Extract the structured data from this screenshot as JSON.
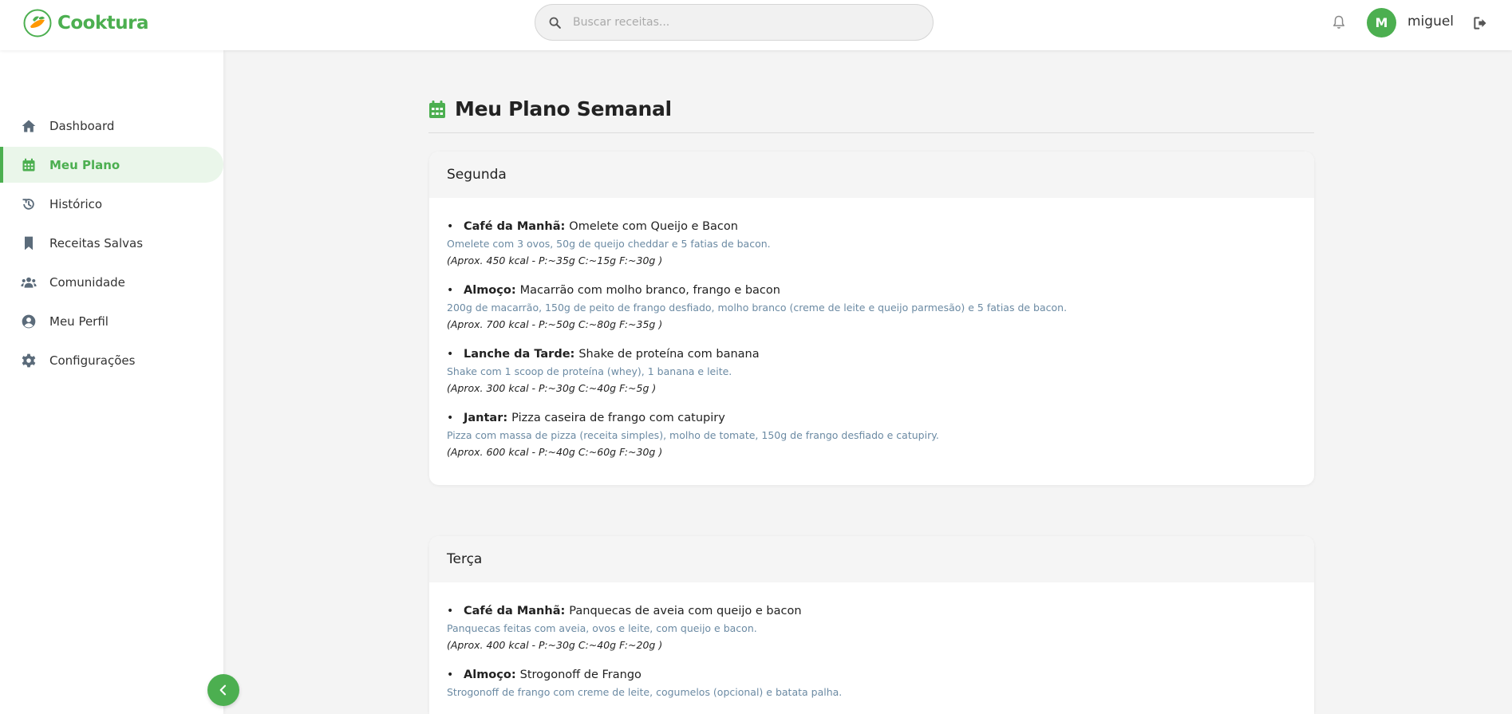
{
  "header": {
    "brand": "Cooktura",
    "search_placeholder": "Buscar receitas...",
    "user_initial": "M",
    "username": "miguel"
  },
  "sidebar": {
    "items": [
      {
        "label": "Dashboard",
        "icon": "home-icon"
      },
      {
        "label": "Meu Plano",
        "icon": "calendar-icon",
        "active": true
      },
      {
        "label": "Histórico",
        "icon": "history-icon"
      },
      {
        "label": "Receitas Salvas",
        "icon": "bookmark-icon"
      },
      {
        "label": "Comunidade",
        "icon": "users-icon"
      },
      {
        "label": "Meu Perfil",
        "icon": "user-circle-icon"
      },
      {
        "label": "Configurações",
        "icon": "gear-icon"
      }
    ]
  },
  "main": {
    "title": "Meu Plano Semanal",
    "days": [
      {
        "name": "Segunda",
        "meals": [
          {
            "type": "Café da Manhã:",
            "name": "Omelete com Queijo e Bacon",
            "desc": "Omelete com 3 ovos, 50g de queijo cheddar e 5 fatias de bacon.",
            "macros": "(Aprox. 450 kcal - P:~35g C:~15g F:~30g )"
          },
          {
            "type": "Almoço:",
            "name": "Macarrão com molho branco, frango e bacon",
            "desc": "200g de macarrão, 150g de peito de frango desfiado, molho branco (creme de leite e queijo parmesão) e 5 fatias de bacon.",
            "macros": "(Aprox. 700 kcal - P:~50g C:~80g F:~35g )"
          },
          {
            "type": "Lanche da Tarde:",
            "name": "Shake de proteína com banana",
            "desc": "Shake com 1 scoop de proteína (whey), 1 banana e leite.",
            "macros": "(Aprox. 300 kcal - P:~30g C:~40g F:~5g )"
          },
          {
            "type": "Jantar:",
            "name": "Pizza caseira de frango com catupiry",
            "desc": "Pizza com massa de pizza (receita simples), molho de tomate, 150g de frango desfiado e catupiry.",
            "macros": "(Aprox. 600 kcal - P:~40g C:~60g F:~30g )"
          }
        ]
      },
      {
        "name": "Terça",
        "meals": [
          {
            "type": "Café da Manhã:",
            "name": "Panquecas de aveia com queijo e bacon",
            "desc": "Panquecas feitas com aveia, ovos e leite, com queijo e bacon.",
            "macros": "(Aprox. 400 kcal - P:~30g C:~40g F:~20g )"
          },
          {
            "type": "Almoço:",
            "name": "Strogonoff de Frango",
            "desc": "Strogonoff de frango com creme de leite, cogumelos (opcional) e batata palha.",
            "macros": ""
          }
        ]
      }
    ]
  },
  "colors": {
    "accent": "#4caf50",
    "desc_text": "#6b8aa3"
  }
}
